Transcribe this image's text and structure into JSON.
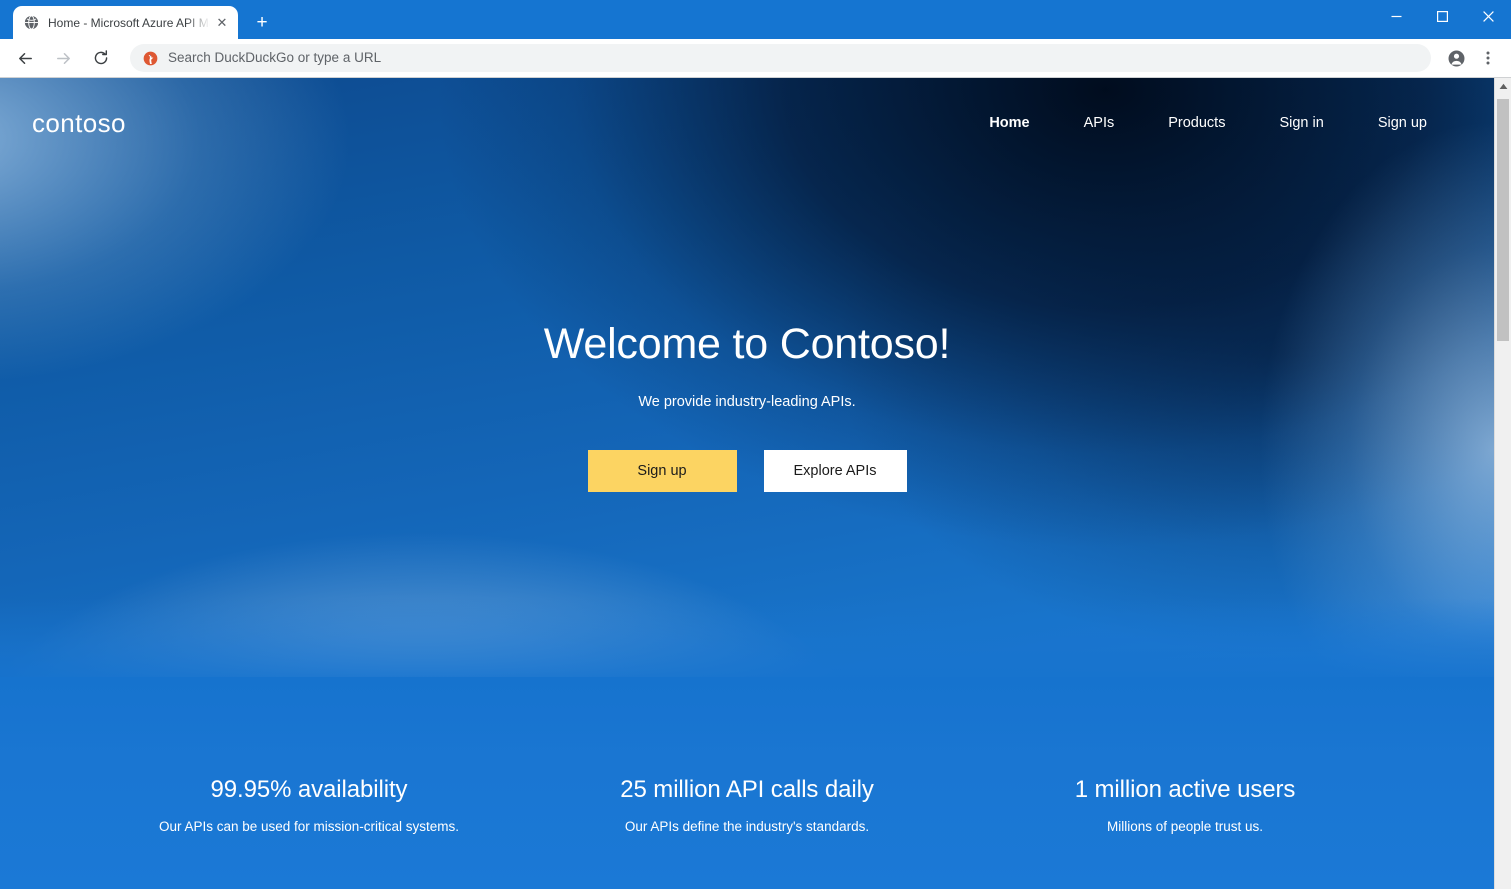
{
  "browser": {
    "tab": {
      "title": "Home - Microsoft Azure API Man",
      "favicon_name": "globe-favicon",
      "close_label": "✕"
    },
    "new_tab_label": "+",
    "window_controls": {
      "minimize_name": "minimize-button",
      "maximize_name": "maximize-button",
      "close_name": "close-window-button"
    },
    "toolbar": {
      "back_name": "back-button",
      "forward_name": "forward-button",
      "reload_name": "reload-button",
      "omnibox_placeholder": "Search DuckDuckGo or type a URL",
      "omnibox_value": "",
      "omnibox_icon_name": "duckduckgo-icon",
      "profile_name": "profile-avatar-icon",
      "menu_name": "three-dot-menu-icon"
    },
    "scrollbar": {
      "up_arrow": "▲",
      "down_arrow": "▼"
    }
  },
  "site": {
    "logo": "contoso",
    "nav": [
      {
        "label": "Home",
        "active": true
      },
      {
        "label": "APIs",
        "active": false
      },
      {
        "label": "Products",
        "active": false
      },
      {
        "label": "Sign in",
        "active": false
      },
      {
        "label": "Sign up",
        "active": false
      }
    ],
    "hero": {
      "title": "Welcome to Contoso!",
      "subtitle": "We provide industry-leading APIs.",
      "primary_button": "Sign up",
      "secondary_button": "Explore APIs"
    },
    "stats": [
      {
        "value": "99.95% availability",
        "description": "Our APIs can be used for mission-critical systems."
      },
      {
        "value": "25 million API calls daily",
        "description": "Our APIs define the industry's standards."
      },
      {
        "value": "1 million active users",
        "description": "Millions of people trust us."
      }
    ]
  },
  "colors": {
    "chrome_blue": "#1575d1",
    "hero_dark": "#021530",
    "hero_blue": "#1b7ad6",
    "accent_yellow": "#fcd462",
    "white": "#ffffff"
  }
}
